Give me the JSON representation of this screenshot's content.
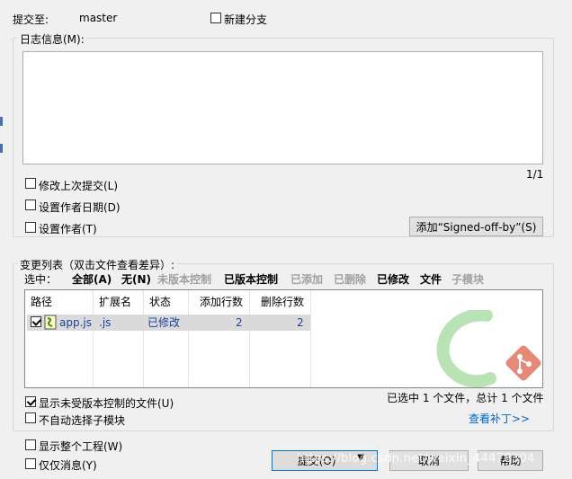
{
  "header": {
    "commit_to_label": "提交至:",
    "branch": "master",
    "new_branch_label": "新建分支"
  },
  "message": {
    "group_title": "日志信息(M):",
    "value": "",
    "counter": "1/1"
  },
  "options": {
    "amend_label": "修改上次提交(L)",
    "set_date_label": "设置作者日期(D)",
    "set_author_label": "设置作者(T)",
    "signoff_button": "添加“Signed-off-by”(S)"
  },
  "changes": {
    "group_title": "变更列表（双击文件查看差异）:",
    "select_label": "选中：",
    "filters": {
      "all": "全部(A)",
      "none": "无(N)",
      "unversioned": "未版本控制",
      "versioned": "已版本控制",
      "added": "已添加",
      "deleted": "已删除",
      "modified": "已修改",
      "files": "文件",
      "submodules": "子模块"
    },
    "columns": {
      "path": "路径",
      "ext": "扩展名",
      "status": "状态",
      "added_lines": "添加行数",
      "deleted_lines": "删除行数"
    },
    "rows": [
      {
        "checked": true,
        "path": "app.js",
        "ext": ".js",
        "status": "已修改",
        "added": "2",
        "deleted": "2"
      }
    ],
    "show_unversioned_label": "显示未受版本控制的文件(U)",
    "no_auto_submodule_label": "不自动选择子模块",
    "selection_summary": "已选中 1 个文件，总计 1 个文件",
    "view_patch_link": "查看补丁>>"
  },
  "footer": {
    "show_whole_project_label": "显示整个工程(W)",
    "message_only_label": "仅仅消息(Y)",
    "commit_button": "提交(O)",
    "cancel_button": "取消",
    "help_button": "帮助",
    "watermark": "https://blog.csdn.net/weixin_44478304"
  },
  "colors": {
    "link": "#0066cc",
    "list_text": "#1a3f9e",
    "git_logo_red": "#e05d44",
    "tortoise_green": "#7fc97f"
  }
}
